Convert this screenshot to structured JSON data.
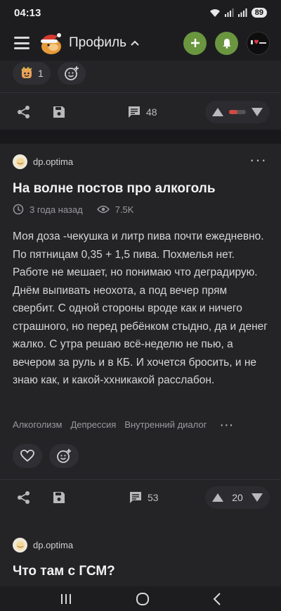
{
  "status_bar": {
    "time": "04:13",
    "battery": "89"
  },
  "header": {
    "title": "Профиль"
  },
  "top_card": {
    "reaction_count": "1",
    "comments_count": "48"
  },
  "post": {
    "author": "dp.optima",
    "title": "На волне постов про алкоголь",
    "time_ago": "3 года назад",
    "views": "7.5K",
    "body": "Моя доза -чекушка и литр пива почти ежедневно. По пятницам 0,35 + 1,5 пива. Похмелья нет. Работе не мешает, но понимаю что деградирую. Днём выпивать неохота, а под вечер прям свербит. С одной стороны вроде как и ничего страшного, но перед ребёнком стыдно, да и денег жалко. С утра решаю всё-неделю не пью, а вечером за руль и в КБ. И хочется бросить, и не знаю как, и какой-ххникакой расслабон.",
    "tags": [
      "Алкоголизм",
      "Депрессия",
      "Внутренний диалог"
    ],
    "comments_count": "53",
    "rating": "20"
  },
  "next_post": {
    "author": "dp.optima",
    "title": "Что там с ГСМ?"
  },
  "colors": {
    "background": "#19191b",
    "card": "#242427",
    "accent_green": "#6a963f"
  }
}
